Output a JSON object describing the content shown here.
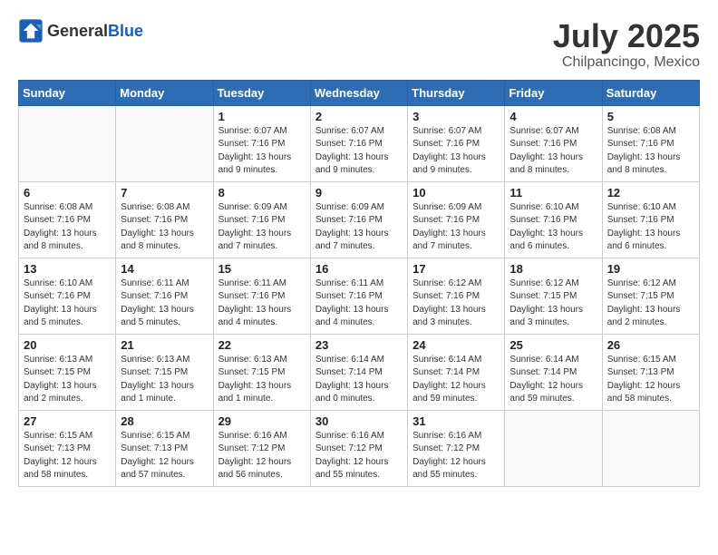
{
  "header": {
    "logo_general": "General",
    "logo_blue": "Blue",
    "month": "July 2025",
    "location": "Chilpancingo, Mexico"
  },
  "weekdays": [
    "Sunday",
    "Monday",
    "Tuesday",
    "Wednesday",
    "Thursday",
    "Friday",
    "Saturday"
  ],
  "weeks": [
    [
      {
        "day": "",
        "info": ""
      },
      {
        "day": "",
        "info": ""
      },
      {
        "day": "1",
        "info": "Sunrise: 6:07 AM\nSunset: 7:16 PM\nDaylight: 13 hours and 9 minutes."
      },
      {
        "day": "2",
        "info": "Sunrise: 6:07 AM\nSunset: 7:16 PM\nDaylight: 13 hours and 9 minutes."
      },
      {
        "day": "3",
        "info": "Sunrise: 6:07 AM\nSunset: 7:16 PM\nDaylight: 13 hours and 9 minutes."
      },
      {
        "day": "4",
        "info": "Sunrise: 6:07 AM\nSunset: 7:16 PM\nDaylight: 13 hours and 8 minutes."
      },
      {
        "day": "5",
        "info": "Sunrise: 6:08 AM\nSunset: 7:16 PM\nDaylight: 13 hours and 8 minutes."
      }
    ],
    [
      {
        "day": "6",
        "info": "Sunrise: 6:08 AM\nSunset: 7:16 PM\nDaylight: 13 hours and 8 minutes."
      },
      {
        "day": "7",
        "info": "Sunrise: 6:08 AM\nSunset: 7:16 PM\nDaylight: 13 hours and 8 minutes."
      },
      {
        "day": "8",
        "info": "Sunrise: 6:09 AM\nSunset: 7:16 PM\nDaylight: 13 hours and 7 minutes."
      },
      {
        "day": "9",
        "info": "Sunrise: 6:09 AM\nSunset: 7:16 PM\nDaylight: 13 hours and 7 minutes."
      },
      {
        "day": "10",
        "info": "Sunrise: 6:09 AM\nSunset: 7:16 PM\nDaylight: 13 hours and 7 minutes."
      },
      {
        "day": "11",
        "info": "Sunrise: 6:10 AM\nSunset: 7:16 PM\nDaylight: 13 hours and 6 minutes."
      },
      {
        "day": "12",
        "info": "Sunrise: 6:10 AM\nSunset: 7:16 PM\nDaylight: 13 hours and 6 minutes."
      }
    ],
    [
      {
        "day": "13",
        "info": "Sunrise: 6:10 AM\nSunset: 7:16 PM\nDaylight: 13 hours and 5 minutes."
      },
      {
        "day": "14",
        "info": "Sunrise: 6:11 AM\nSunset: 7:16 PM\nDaylight: 13 hours and 5 minutes."
      },
      {
        "day": "15",
        "info": "Sunrise: 6:11 AM\nSunset: 7:16 PM\nDaylight: 13 hours and 4 minutes."
      },
      {
        "day": "16",
        "info": "Sunrise: 6:11 AM\nSunset: 7:16 PM\nDaylight: 13 hours and 4 minutes."
      },
      {
        "day": "17",
        "info": "Sunrise: 6:12 AM\nSunset: 7:16 PM\nDaylight: 13 hours and 3 minutes."
      },
      {
        "day": "18",
        "info": "Sunrise: 6:12 AM\nSunset: 7:15 PM\nDaylight: 13 hours and 3 minutes."
      },
      {
        "day": "19",
        "info": "Sunrise: 6:12 AM\nSunset: 7:15 PM\nDaylight: 13 hours and 2 minutes."
      }
    ],
    [
      {
        "day": "20",
        "info": "Sunrise: 6:13 AM\nSunset: 7:15 PM\nDaylight: 13 hours and 2 minutes."
      },
      {
        "day": "21",
        "info": "Sunrise: 6:13 AM\nSunset: 7:15 PM\nDaylight: 13 hours and 1 minute."
      },
      {
        "day": "22",
        "info": "Sunrise: 6:13 AM\nSunset: 7:15 PM\nDaylight: 13 hours and 1 minute."
      },
      {
        "day": "23",
        "info": "Sunrise: 6:14 AM\nSunset: 7:14 PM\nDaylight: 13 hours and 0 minutes."
      },
      {
        "day": "24",
        "info": "Sunrise: 6:14 AM\nSunset: 7:14 PM\nDaylight: 12 hours and 59 minutes."
      },
      {
        "day": "25",
        "info": "Sunrise: 6:14 AM\nSunset: 7:14 PM\nDaylight: 12 hours and 59 minutes."
      },
      {
        "day": "26",
        "info": "Sunrise: 6:15 AM\nSunset: 7:13 PM\nDaylight: 12 hours and 58 minutes."
      }
    ],
    [
      {
        "day": "27",
        "info": "Sunrise: 6:15 AM\nSunset: 7:13 PM\nDaylight: 12 hours and 58 minutes."
      },
      {
        "day": "28",
        "info": "Sunrise: 6:15 AM\nSunset: 7:13 PM\nDaylight: 12 hours and 57 minutes."
      },
      {
        "day": "29",
        "info": "Sunrise: 6:16 AM\nSunset: 7:12 PM\nDaylight: 12 hours and 56 minutes."
      },
      {
        "day": "30",
        "info": "Sunrise: 6:16 AM\nSunset: 7:12 PM\nDaylight: 12 hours and 55 minutes."
      },
      {
        "day": "31",
        "info": "Sunrise: 6:16 AM\nSunset: 7:12 PM\nDaylight: 12 hours and 55 minutes."
      },
      {
        "day": "",
        "info": ""
      },
      {
        "day": "",
        "info": ""
      }
    ]
  ]
}
